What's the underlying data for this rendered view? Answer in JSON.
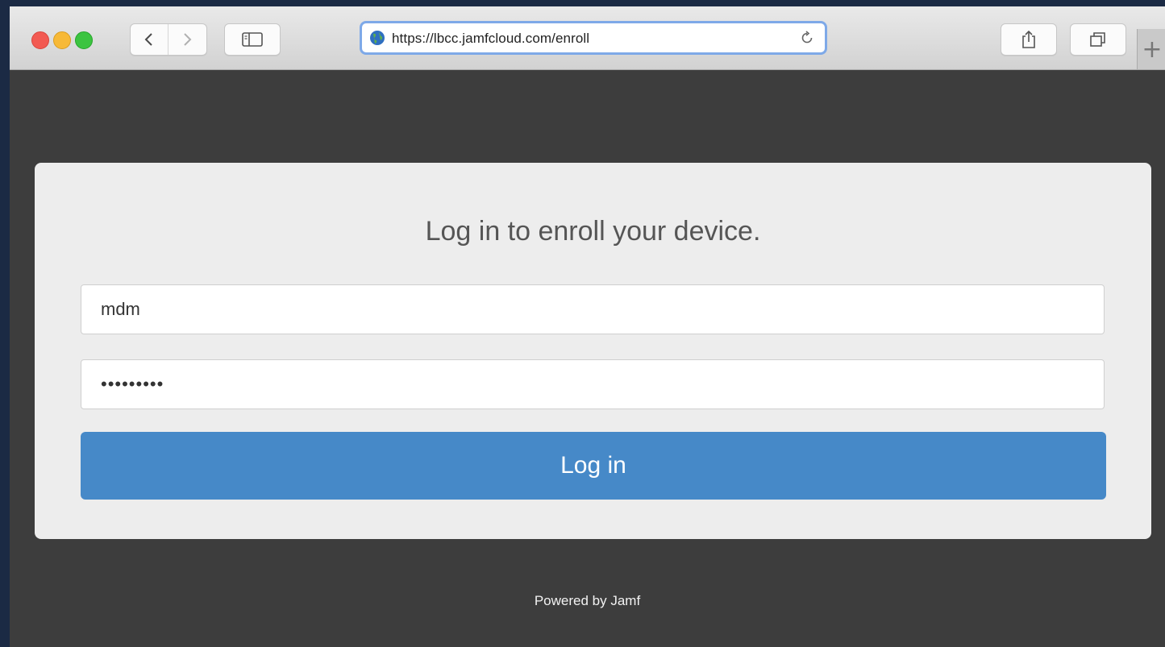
{
  "browser": {
    "url": "https://lbcc.jamfcloud.com/enroll",
    "new_tab_label": "+"
  },
  "login": {
    "heading": "Log in to enroll your device.",
    "username_value": "mdm",
    "password_value": "•••••••••",
    "submit_label": "Log in"
  },
  "footer": {
    "text": "Powered by Jamf"
  },
  "colors": {
    "button": "#4689c8",
    "card": "#ededed",
    "page": "#3d3d3d",
    "address_focus": "#7ea9e8"
  },
  "icons": {
    "back": "chevron-left-icon",
    "forward": "chevron-right-icon",
    "sidebar": "sidebar-icon",
    "site": "globe-icon",
    "reload": "reload-icon",
    "share": "share-icon",
    "tabs": "tabs-overview-icon"
  }
}
